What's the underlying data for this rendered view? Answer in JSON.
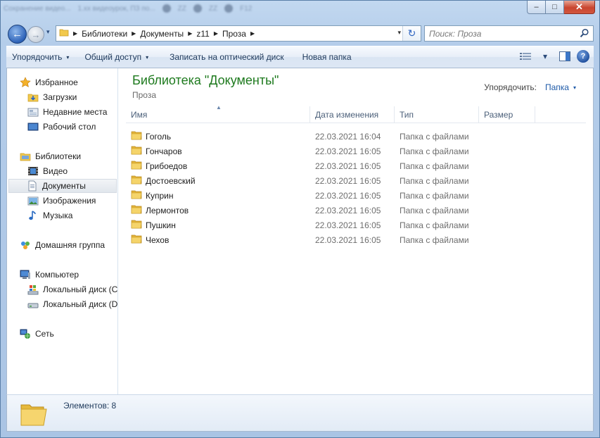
{
  "window": {
    "titlebar_blurred_text": [
      "Сохранение видео...",
      "1.xx видеоурок, ПЗ по...",
      "ZZ",
      "ZZ",
      "F12"
    ],
    "minimize_glyph": "–",
    "maximize_glyph": "□",
    "close_glyph": "✕"
  },
  "nav": {
    "back_glyph": "←",
    "forward_glyph": "→",
    "history_dropdown_glyph": "▾",
    "breadcrumbs": [
      "Библиотеки",
      "Документы",
      "z11",
      "Проза"
    ],
    "address_dropdown_glyph": "▾",
    "refresh_glyph": "↻",
    "search_placeholder": "Поиск: Проза",
    "search_icon_glyph": "⌕"
  },
  "toolbar": {
    "organize": "Упорядочить",
    "share": "Общий доступ",
    "burn": "Записать на оптический диск",
    "new_folder": "Новая папка",
    "caret": "▾",
    "help": "?"
  },
  "sidebar": {
    "favorites": {
      "label": "Избранное",
      "icon": "star-icon"
    },
    "downloads": {
      "label": "Загрузки",
      "icon": "downloads-icon"
    },
    "recent": {
      "label": "Недавние места",
      "icon": "recent-places-icon"
    },
    "desktop": {
      "label": "Рабочий стол",
      "icon": "desktop-icon"
    },
    "libraries": {
      "label": "Библиотеки",
      "icon": "libraries-icon"
    },
    "video": {
      "label": "Видео",
      "icon": "video-icon"
    },
    "documents": {
      "label": "Документы",
      "icon": "documents-icon"
    },
    "pictures": {
      "label": "Изображения",
      "icon": "pictures-icon"
    },
    "music": {
      "label": "Музыка",
      "icon": "music-icon"
    },
    "homegroup": {
      "label": "Домашняя группа",
      "icon": "homegroup-icon"
    },
    "computer": {
      "label": "Компьютер",
      "icon": "computer-icon"
    },
    "disk_c": {
      "label": "Локальный диск (C",
      "icon": "disk-c-icon"
    },
    "disk_d": {
      "label": "Локальный диск (D",
      "icon": "disk-d-icon"
    },
    "network": {
      "label": "Сеть",
      "icon": "network-icon"
    }
  },
  "content": {
    "library_title": "Библиотека \"Документы\"",
    "library_subtitle": "Проза",
    "arrange_label": "Упорядочить:",
    "arrange_value": "Папка",
    "columns": {
      "name": "Имя",
      "date": "Дата изменения",
      "type": "Тип",
      "size": "Размер"
    },
    "sort_indicator": "▲",
    "rows": [
      {
        "name": "Гоголь",
        "date": "22.03.2021 16:04",
        "type": "Папка с файлами"
      },
      {
        "name": "Гончаров",
        "date": "22.03.2021 16:05",
        "type": "Папка с файлами"
      },
      {
        "name": "Грибоедов",
        "date": "22.03.2021 16:05",
        "type": "Папка с файлами"
      },
      {
        "name": "Достоевский",
        "date": "22.03.2021 16:05",
        "type": "Папка с файлами"
      },
      {
        "name": "Куприн",
        "date": "22.03.2021 16:05",
        "type": "Папка с файлами"
      },
      {
        "name": "Лермонтов",
        "date": "22.03.2021 16:05",
        "type": "Папка с файлами"
      },
      {
        "name": "Пушкин",
        "date": "22.03.2021 16:05",
        "type": "Папка с файлами"
      },
      {
        "name": "Чехов",
        "date": "22.03.2021 16:05",
        "type": "Папка с файлами"
      }
    ]
  },
  "status": {
    "items_text": "Элементов: 8"
  },
  "colors": {
    "library_title": "#1e7a1e",
    "link_blue": "#1e5aa8",
    "folder_yellow": "#f2c94c"
  }
}
